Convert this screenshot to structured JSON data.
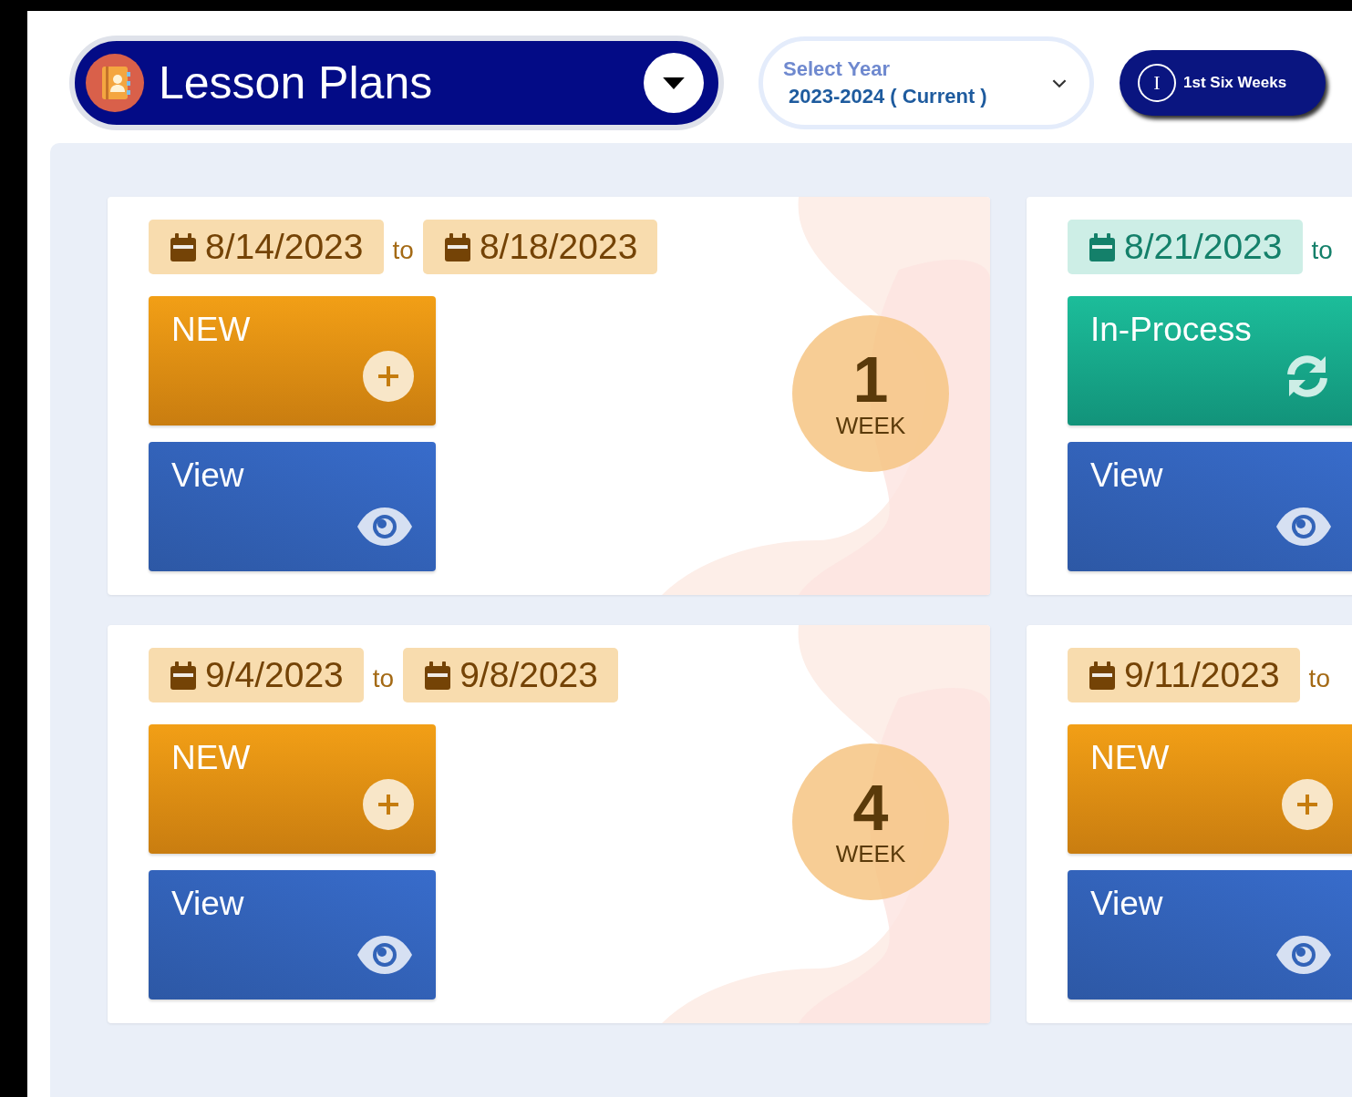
{
  "header": {
    "title": "Lesson Plans",
    "year_select": {
      "label": "Select Year",
      "value": "2023-2024 ( Current )"
    },
    "period_button": {
      "letter": "I",
      "label": "1st Six Weeks"
    }
  },
  "weeks": [
    {
      "kind": "new",
      "start": "8/14/2023",
      "to": "to",
      "end": "8/18/2023",
      "action": "NEW",
      "view": "View",
      "week_number": "1",
      "week_label": "WEEK"
    },
    {
      "kind": "in_process",
      "start": "8/21/2023",
      "to": "to",
      "action": "In-Process",
      "view": "View"
    },
    {
      "kind": "new",
      "start": "9/4/2023",
      "to": "to",
      "end": "9/8/2023",
      "action": "NEW",
      "view": "View",
      "week_number": "4",
      "week_label": "WEEK"
    },
    {
      "kind": "new",
      "start": "9/11/2023",
      "to": "to",
      "action": "NEW",
      "view": "View"
    }
  ]
}
